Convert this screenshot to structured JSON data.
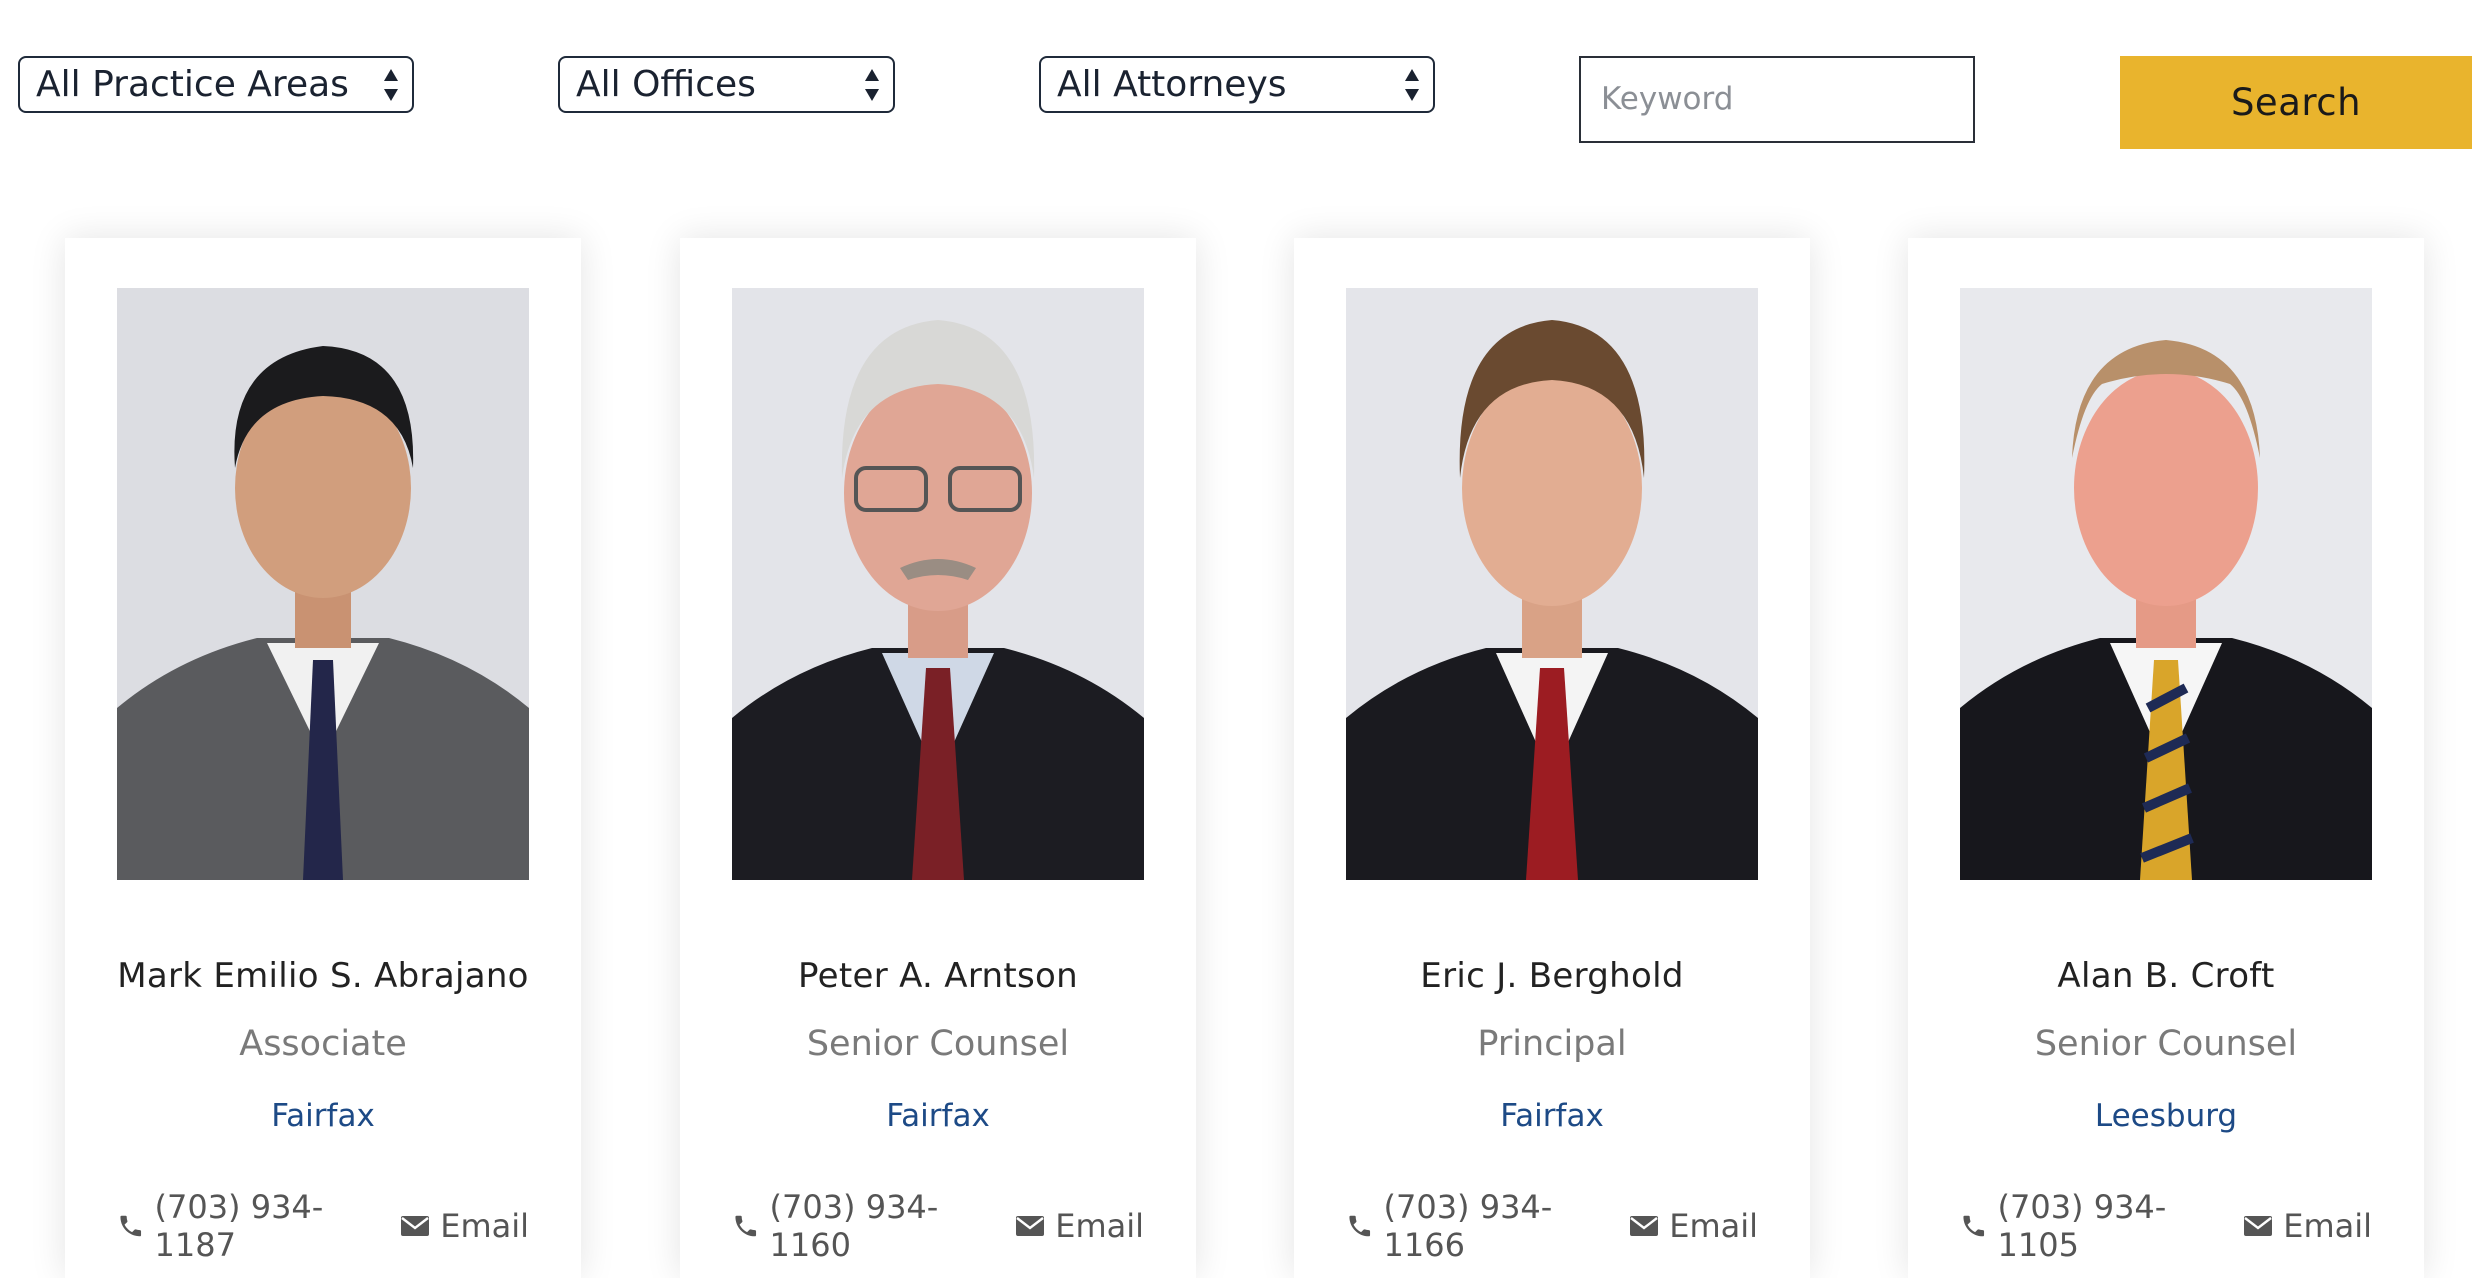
{
  "filters": {
    "practice_areas": "All Practice Areas",
    "offices": "All Offices",
    "attorneys": "All Attorneys",
    "keyword_placeholder": "Keyword",
    "search_label": "Search"
  },
  "colors": {
    "accent": "#e9b42d",
    "office_link": "#1d4a86"
  },
  "attorneys": [
    {
      "name": "Mark Emilio S. Abrajano",
      "title": "Associate",
      "office": "Fairfax",
      "phone": "(703) 934-1187",
      "email_label": "Email"
    },
    {
      "name": "Peter A. Arntson",
      "title": "Senior Counsel",
      "office": "Fairfax",
      "phone": "(703) 934-1160",
      "email_label": "Email"
    },
    {
      "name": "Eric J. Berghold",
      "title": "Principal",
      "office": "Fairfax",
      "phone": "(703) 934-1166",
      "email_label": "Email"
    },
    {
      "name": "Alan B. Croft",
      "title": "Senior Counsel",
      "office": "Leesburg",
      "phone": "(703) 934-1105",
      "email_label": "Email"
    }
  ]
}
